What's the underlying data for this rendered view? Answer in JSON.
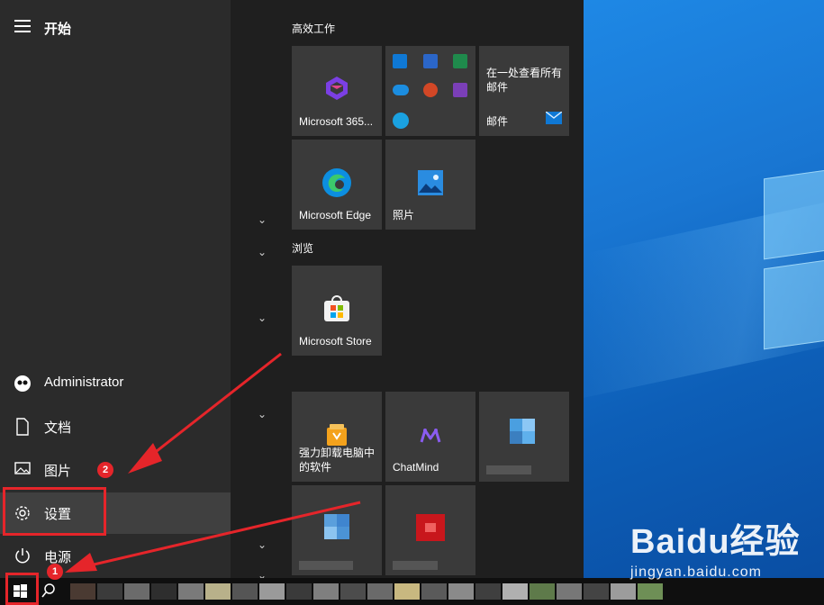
{
  "start_menu": {
    "title": "开始",
    "rail": [
      {
        "label": "Administrator",
        "icon": "user-avatar-icon"
      },
      {
        "label": "文档",
        "icon": "document-icon"
      },
      {
        "label": "图片",
        "icon": "picture-icon"
      },
      {
        "label": "设置",
        "icon": "gear-icon"
      },
      {
        "label": "电源",
        "icon": "power-icon"
      }
    ],
    "groups": [
      {
        "title": "高效工作"
      },
      {
        "title": "浏览"
      }
    ],
    "tiles": {
      "m365": "Microsoft 365...",
      "mail_preview": "在一处查看所有邮件",
      "mail": "邮件",
      "edge": "Microsoft Edge",
      "photos": "照片",
      "store": "Microsoft Store",
      "uninstaller": "强力卸载电脑中的软件",
      "chatmind": "ChatMind"
    }
  },
  "annotations": {
    "badge1": "1",
    "badge2": "2"
  },
  "watermark": {
    "brand": "Baidu经验",
    "url": "jingyan.baidu.com"
  },
  "colors": {
    "annotation_red": "#e5252a",
    "desktop_blue": "#1976d2",
    "menu_bg": "#2b2b2b"
  }
}
